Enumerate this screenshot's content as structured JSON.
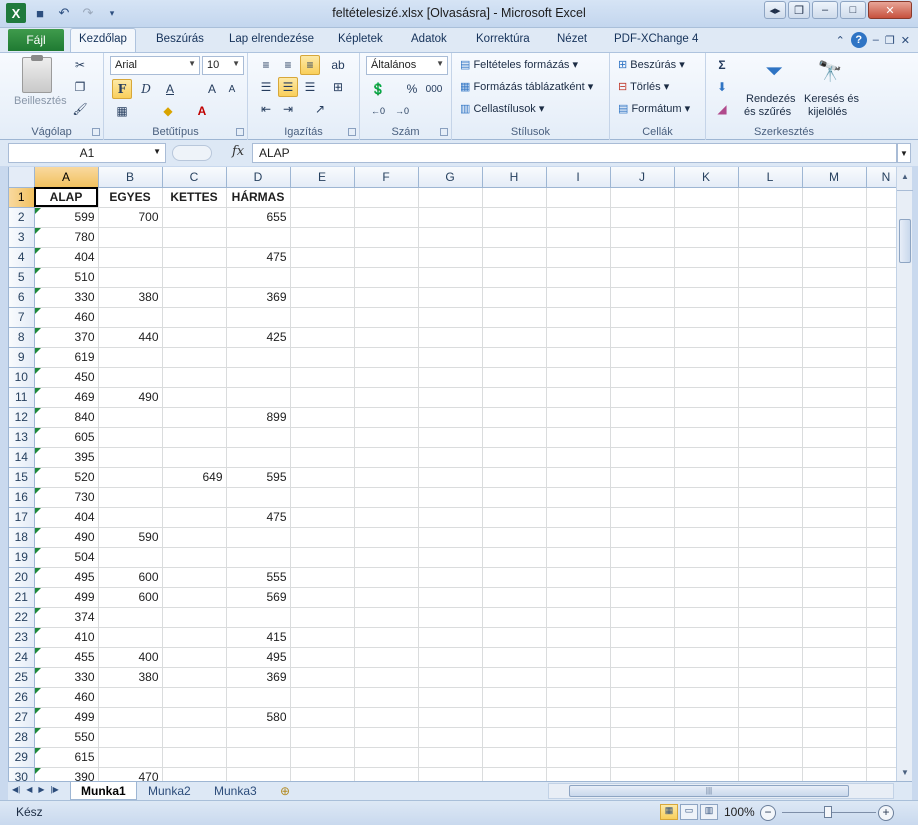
{
  "window": {
    "title": "feltételesizé.xlsx  [Olvasásra]  -  Microsoft Excel",
    "app_icon": "excel-icon",
    "accent": "#1f7a32"
  },
  "tabs": {
    "file": "Fájl",
    "items": [
      "Kezdőlap",
      "Beszúrás",
      "Lap elrendezése",
      "Képletek",
      "Adatok",
      "Korrektúra",
      "Nézet",
      "PDF-XChange 4"
    ],
    "active": "Kezdőlap"
  },
  "ribbon": {
    "clipboard": {
      "label": "Vágólap",
      "paste": "Beillesztés"
    },
    "font": {
      "label": "Betűtípus",
      "name": "Arial",
      "size": "10",
      "bold": "F",
      "italic": "D",
      "underline": "A"
    },
    "alignment": {
      "label": "Igazítás"
    },
    "number": {
      "label": "Szám",
      "format": "Általános",
      "percent": "%",
      "thousands": "000"
    },
    "styles": {
      "label": "Stílusok",
      "conditional": "Feltételes formázás",
      "table": "Formázás táblázatként",
      "cell_styles": "Cellastílusok"
    },
    "cells": {
      "label": "Cellák",
      "insert": "Beszúrás",
      "delete": "Törlés",
      "format": "Formátum"
    },
    "editing": {
      "label": "Szerkesztés",
      "sort_line1": "Rendezés",
      "sort_line2": "és szűrés",
      "find_line1": "Keresés és",
      "find_line2": "kijelölés"
    }
  },
  "formula_bar": {
    "name_box": "A1",
    "fx": "fx",
    "content": "ALAP"
  },
  "sheet": {
    "columns": [
      "A",
      "B",
      "C",
      "D",
      "E",
      "F",
      "G",
      "H",
      "I",
      "J",
      "K",
      "L",
      "M",
      "N"
    ],
    "selected_column": "A",
    "selected_row": 1,
    "rows": [
      [
        "ALAP",
        "EGYES",
        "KETTES",
        "HÁRMAS"
      ],
      [
        "599",
        "700",
        "",
        "655"
      ],
      [
        "780",
        "",
        "",
        ""
      ],
      [
        "404",
        "",
        "",
        "475"
      ],
      [
        "510",
        "",
        "",
        ""
      ],
      [
        "330",
        "380",
        "",
        "369"
      ],
      [
        "460",
        "",
        "",
        ""
      ],
      [
        "370",
        "440",
        "",
        "425"
      ],
      [
        "619",
        "",
        "",
        ""
      ],
      [
        "450",
        "",
        "",
        ""
      ],
      [
        "469",
        "490",
        "",
        ""
      ],
      [
        "840",
        "",
        "",
        "899"
      ],
      [
        "605",
        "",
        "",
        ""
      ],
      [
        "395",
        "",
        "",
        ""
      ],
      [
        "520",
        "",
        "649",
        "595"
      ],
      [
        "730",
        "",
        "",
        ""
      ],
      [
        "404",
        "",
        "",
        "475"
      ],
      [
        "490",
        "590",
        "",
        ""
      ],
      [
        "504",
        "",
        "",
        ""
      ],
      [
        "495",
        "600",
        "",
        "555"
      ],
      [
        "499",
        "600",
        "",
        "569"
      ],
      [
        "374",
        "",
        "",
        ""
      ],
      [
        "410",
        "",
        "",
        "415"
      ],
      [
        "455",
        "400",
        "",
        "495"
      ],
      [
        "330",
        "380",
        "",
        "369"
      ],
      [
        "460",
        "",
        "",
        ""
      ],
      [
        "499",
        "",
        "",
        "580"
      ],
      [
        "550",
        "",
        "",
        ""
      ],
      [
        "615",
        "",
        "",
        ""
      ],
      [
        "390",
        "470",
        "",
        ""
      ]
    ]
  },
  "sheet_tabs": [
    "Munka1",
    "Munka2",
    "Munka3"
  ],
  "active_sheet": "Munka1",
  "status": {
    "text": "Kész",
    "zoom": "100%"
  }
}
